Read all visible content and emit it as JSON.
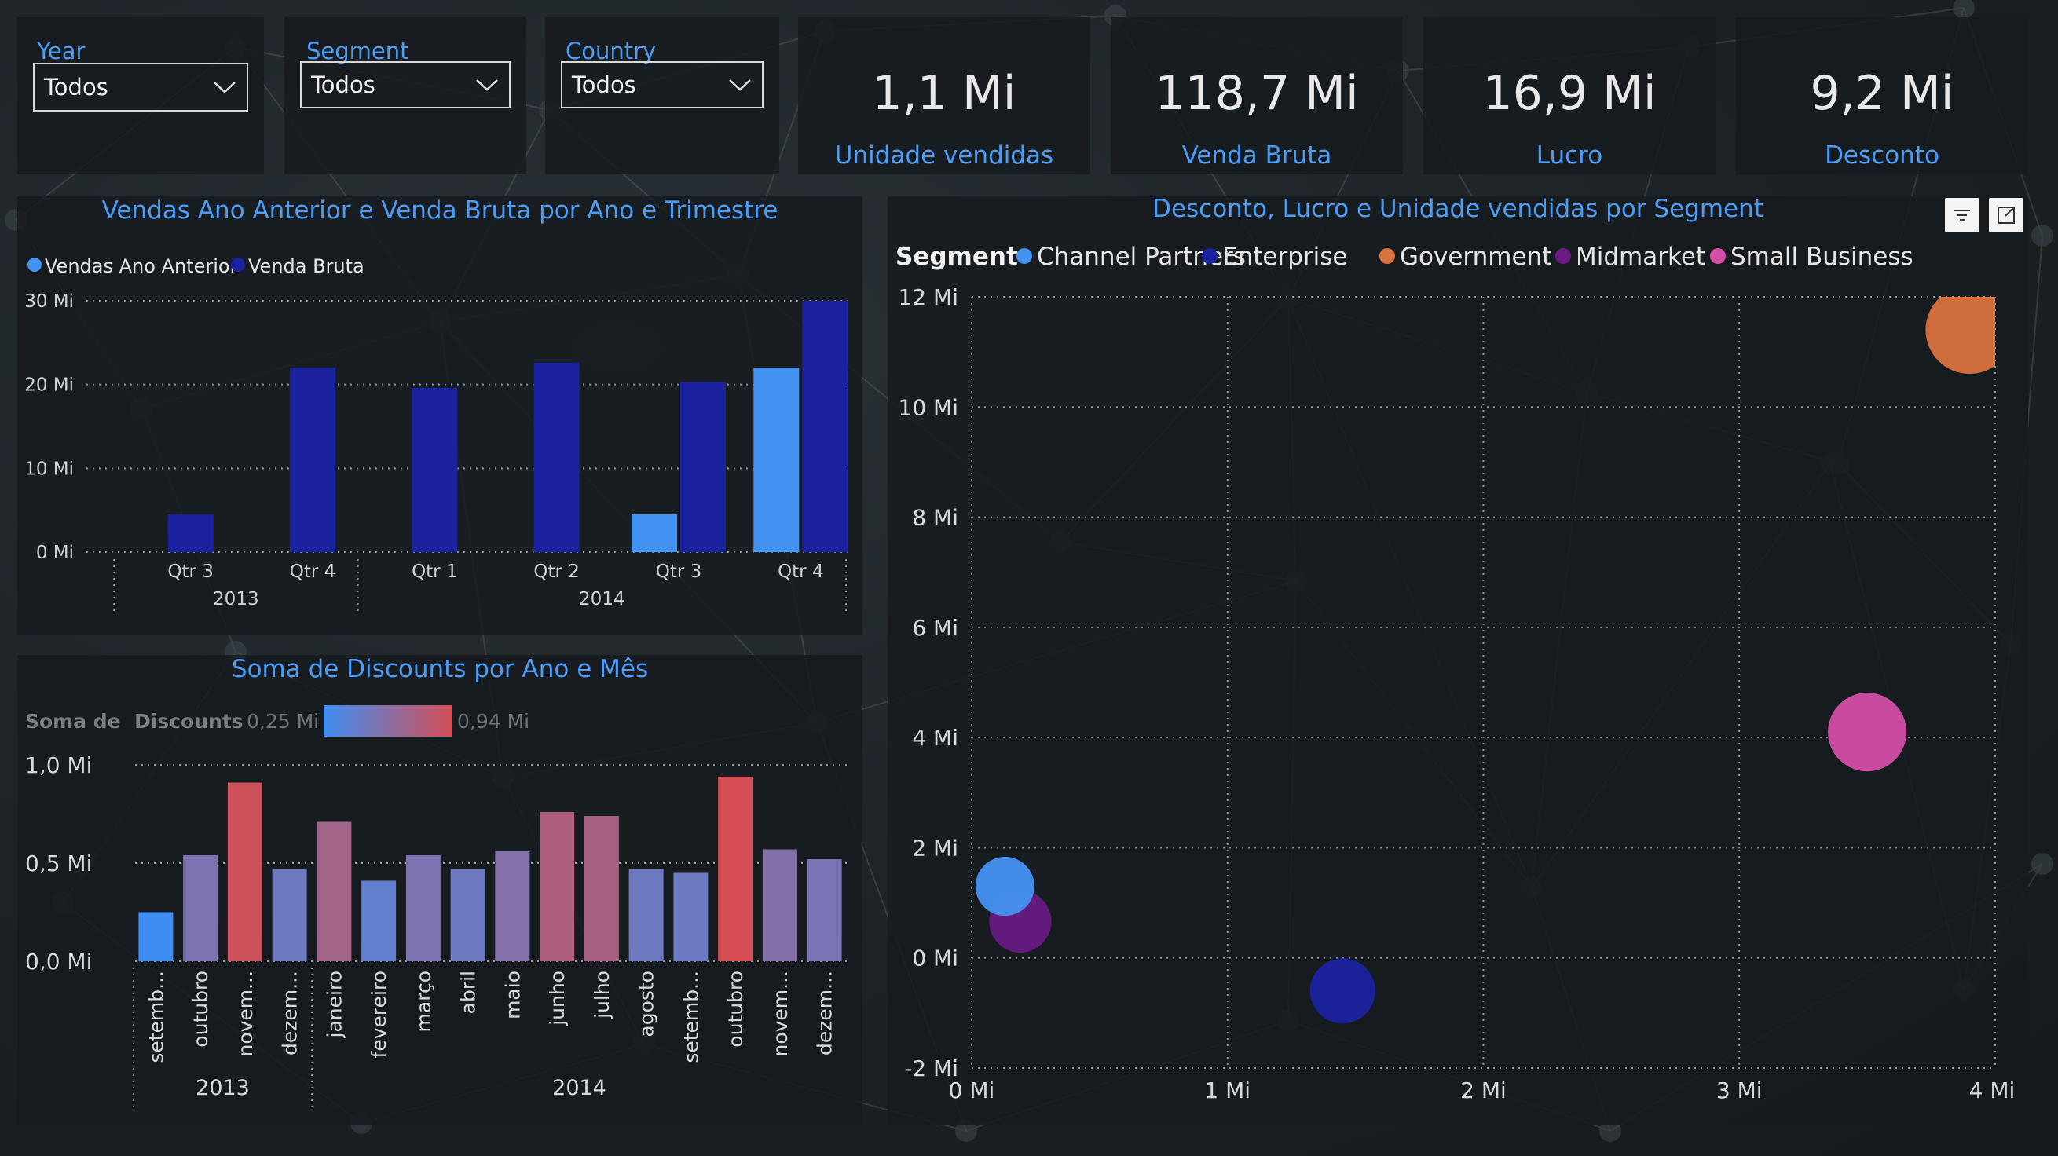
{
  "slicers": [
    {
      "title": "Year",
      "value": "Todos"
    },
    {
      "title": "Segment",
      "value": "Todos"
    },
    {
      "title": "Country",
      "value": "Todos"
    }
  ],
  "kpis": [
    {
      "value": "1,1 Mi",
      "label": "Unidade vendidas"
    },
    {
      "value": "118,7 Mi",
      "label": "Venda Bruta"
    },
    {
      "value": "16,9 Mi",
      "label": "Lucro"
    },
    {
      "value": "9,2 Mi",
      "label": "Desconto"
    }
  ],
  "colors": {
    "accent": "#4d9cf5",
    "vendas_ano_anterior": "#4392f1",
    "venda_bruta": "#1a22a0",
    "gradient_low": "#3e8df2",
    "gradient_high": "#d54f55",
    "channel_partners": "#4392f1",
    "enterprise": "#1a22a0",
    "government": "#d9723e",
    "midmarket": "#6a1b86",
    "small_business": "#d34ea6"
  },
  "header_icons": [
    "filter-icon",
    "focus-mode-icon"
  ],
  "chart_data": [
    {
      "type": "bar",
      "title": "Vendas Ano Anterior e Venda Bruta por Ano e Trimestre",
      "categories": [
        "Qtr 3",
        "Qtr 4",
        "Qtr 1",
        "Qtr 2",
        "Qtr 3",
        "Qtr 4"
      ],
      "groups": [
        {
          "label": "2013",
          "span": [
            0,
            1
          ]
        },
        {
          "label": "2014",
          "span": [
            2,
            5
          ]
        }
      ],
      "series": [
        {
          "name": "Vendas Ano Anterior",
          "values": [
            0,
            0,
            0,
            0,
            4.5,
            22
          ]
        },
        {
          "name": "Venda Bruta",
          "values": [
            4.5,
            22,
            19.6,
            22.6,
            20.3,
            30
          ]
        }
      ],
      "yticks": [
        "0 Mi",
        "10 Mi",
        "20 Mi",
        "30 Mi"
      ],
      "ylim": [
        0,
        30
      ],
      "legend": "top-left",
      "grid": true
    },
    {
      "type": "bar",
      "title": "Soma de Discounts por Ano e Mês",
      "legend_title": "Soma de  Discounts",
      "legend_min": "0,25 Mi",
      "legend_max": "0,94 Mi",
      "color_range": [
        0.25,
        0.94
      ],
      "categories": [
        "setemb...",
        "outubro",
        "novem...",
        "dezem...",
        "janeiro",
        "fevereiro",
        "março",
        "abril",
        "maio",
        "junho",
        "julho",
        "agosto",
        "setemb...",
        "outubro",
        "novem...",
        "dezem..."
      ],
      "groups": [
        {
          "label": "2013",
          "span": [
            0,
            3
          ]
        },
        {
          "label": "2014",
          "span": [
            4,
            15
          ]
        }
      ],
      "values": [
        0.25,
        0.54,
        0.91,
        0.47,
        0.71,
        0.41,
        0.54,
        0.47,
        0.56,
        0.76,
        0.74,
        0.47,
        0.45,
        0.94,
        0.57,
        0.52
      ],
      "yticks": [
        "0,0 Mi",
        "0,5 Mi",
        "1,0 Mi"
      ],
      "ylim": [
        0,
        1.0
      ],
      "grid": true
    },
    {
      "type": "scatter",
      "title": "Desconto, Lucro e Unidade vendidas por Segment",
      "legend_title": "Segment",
      "legend": "top-left",
      "series": [
        {
          "name": "Channel Partners",
          "x": 0.13,
          "y": 1.3,
          "size": 0.09
        },
        {
          "name": "Enterprise",
          "x": 1.45,
          "y": -0.6,
          "size": 0.11
        },
        {
          "name": "Government",
          "x": 3.9,
          "y": 11.4,
          "size": 0.2
        },
        {
          "name": "Midmarket",
          "x": 0.19,
          "y": 0.66,
          "size": 0.1
        },
        {
          "name": "Small Business",
          "x": 3.5,
          "y": 4.1,
          "size": 0.16
        }
      ],
      "xticks": [
        "0 Mi",
        "1 Mi",
        "2 Mi",
        "3 Mi",
        "4 Mi"
      ],
      "yticks": [
        "-2 Mi",
        "0 Mi",
        "2 Mi",
        "4 Mi",
        "6 Mi",
        "8 Mi",
        "10 Mi",
        "12 Mi"
      ],
      "xlim": [
        0,
        4
      ],
      "ylim": [
        -2,
        12
      ],
      "grid": true
    }
  ]
}
